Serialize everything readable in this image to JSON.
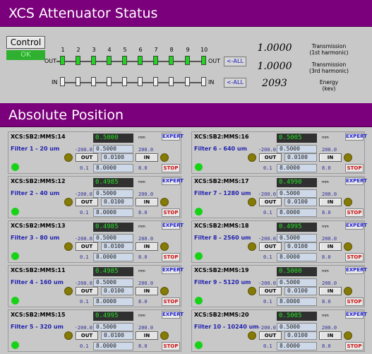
{
  "header": {
    "title": "XCS Attenuator Status"
  },
  "status": {
    "control_label": "Control",
    "ok_label": "OK",
    "filter_numbers": [
      "1",
      "2",
      "3",
      "4",
      "5",
      "6",
      "7",
      "8",
      "9",
      "10"
    ],
    "out_label": "OUT",
    "in_label": "IN",
    "out_all_label": "<-ALL",
    "in_all_label": "<-ALL",
    "out_states": [
      "on",
      "on",
      "on",
      "on",
      "on",
      "on",
      "on",
      "on",
      "on",
      "on"
    ],
    "in_states": [
      "off",
      "off",
      "off",
      "off",
      "off",
      "off",
      "off",
      "off",
      "off",
      "off"
    ],
    "readouts": [
      {
        "value": "1.0000",
        "label": "Transmission\n(1st harmonic)"
      },
      {
        "value": "1.0000",
        "label": "Transmission\n(3rd harmonic)"
      },
      {
        "value": "2093",
        "label": "Energy\n(kev)"
      }
    ]
  },
  "section": {
    "title": "Absolute Position"
  },
  "tile_common": {
    "unit": "mm",
    "expert_label": "EXPERT",
    "low_limit": "-200.0",
    "high_limit": "200.0",
    "out_button": "OUT",
    "in_button": "IN",
    "step_low": "0.1",
    "step_high": "8.0",
    "stop_label": "STOP",
    "setpoint": "0.5000",
    "tweak": "0.0100",
    "step": "8.0000"
  },
  "filters": [
    {
      "pv": "XCS:SB2:MMS:14",
      "name": "Filter 1 - 20 um",
      "readback": "0.5000"
    },
    {
      "pv": "XCS:SB2:MMS:12",
      "name": "Filter 2 - 40 um",
      "readback": "0.4985"
    },
    {
      "pv": "XCS:SB2:MMS:13",
      "name": "Filter 3 - 80 um",
      "readback": "0.4985"
    },
    {
      "pv": "XCS:SB2:MMS:11",
      "name": "Filter 4 - 160 um",
      "readback": "0.4985"
    },
    {
      "pv": "XCS:SB2:MMS:15",
      "name": "Filter 5 - 320 um",
      "readback": "0.4995"
    },
    {
      "pv": "XCS:SB2:MMS:16",
      "name": "Filter 6 - 640 um",
      "readback": "0.5005"
    },
    {
      "pv": "XCS:SB2:MMS:17",
      "name": "Filter 7 - 1280 um",
      "readback": "0.4990"
    },
    {
      "pv": "XCS:SB2:MMS:18",
      "name": "Filter 8 - 2560 um",
      "readback": "0.4995"
    },
    {
      "pv": "XCS:SB2:MMS:19",
      "name": "Filter 9 - 5120 um",
      "readback": "0.5000"
    },
    {
      "pv": "XCS:SB2:MMS:20",
      "name": "Filter 10 - 10240 um",
      "readback": "0.5005"
    }
  ],
  "colors": {
    "banner": "#7b007b",
    "led_on": "#1ed41e",
    "readback_bg": "#303030",
    "readback_fg": "#26e026",
    "stop": "#d01010"
  }
}
